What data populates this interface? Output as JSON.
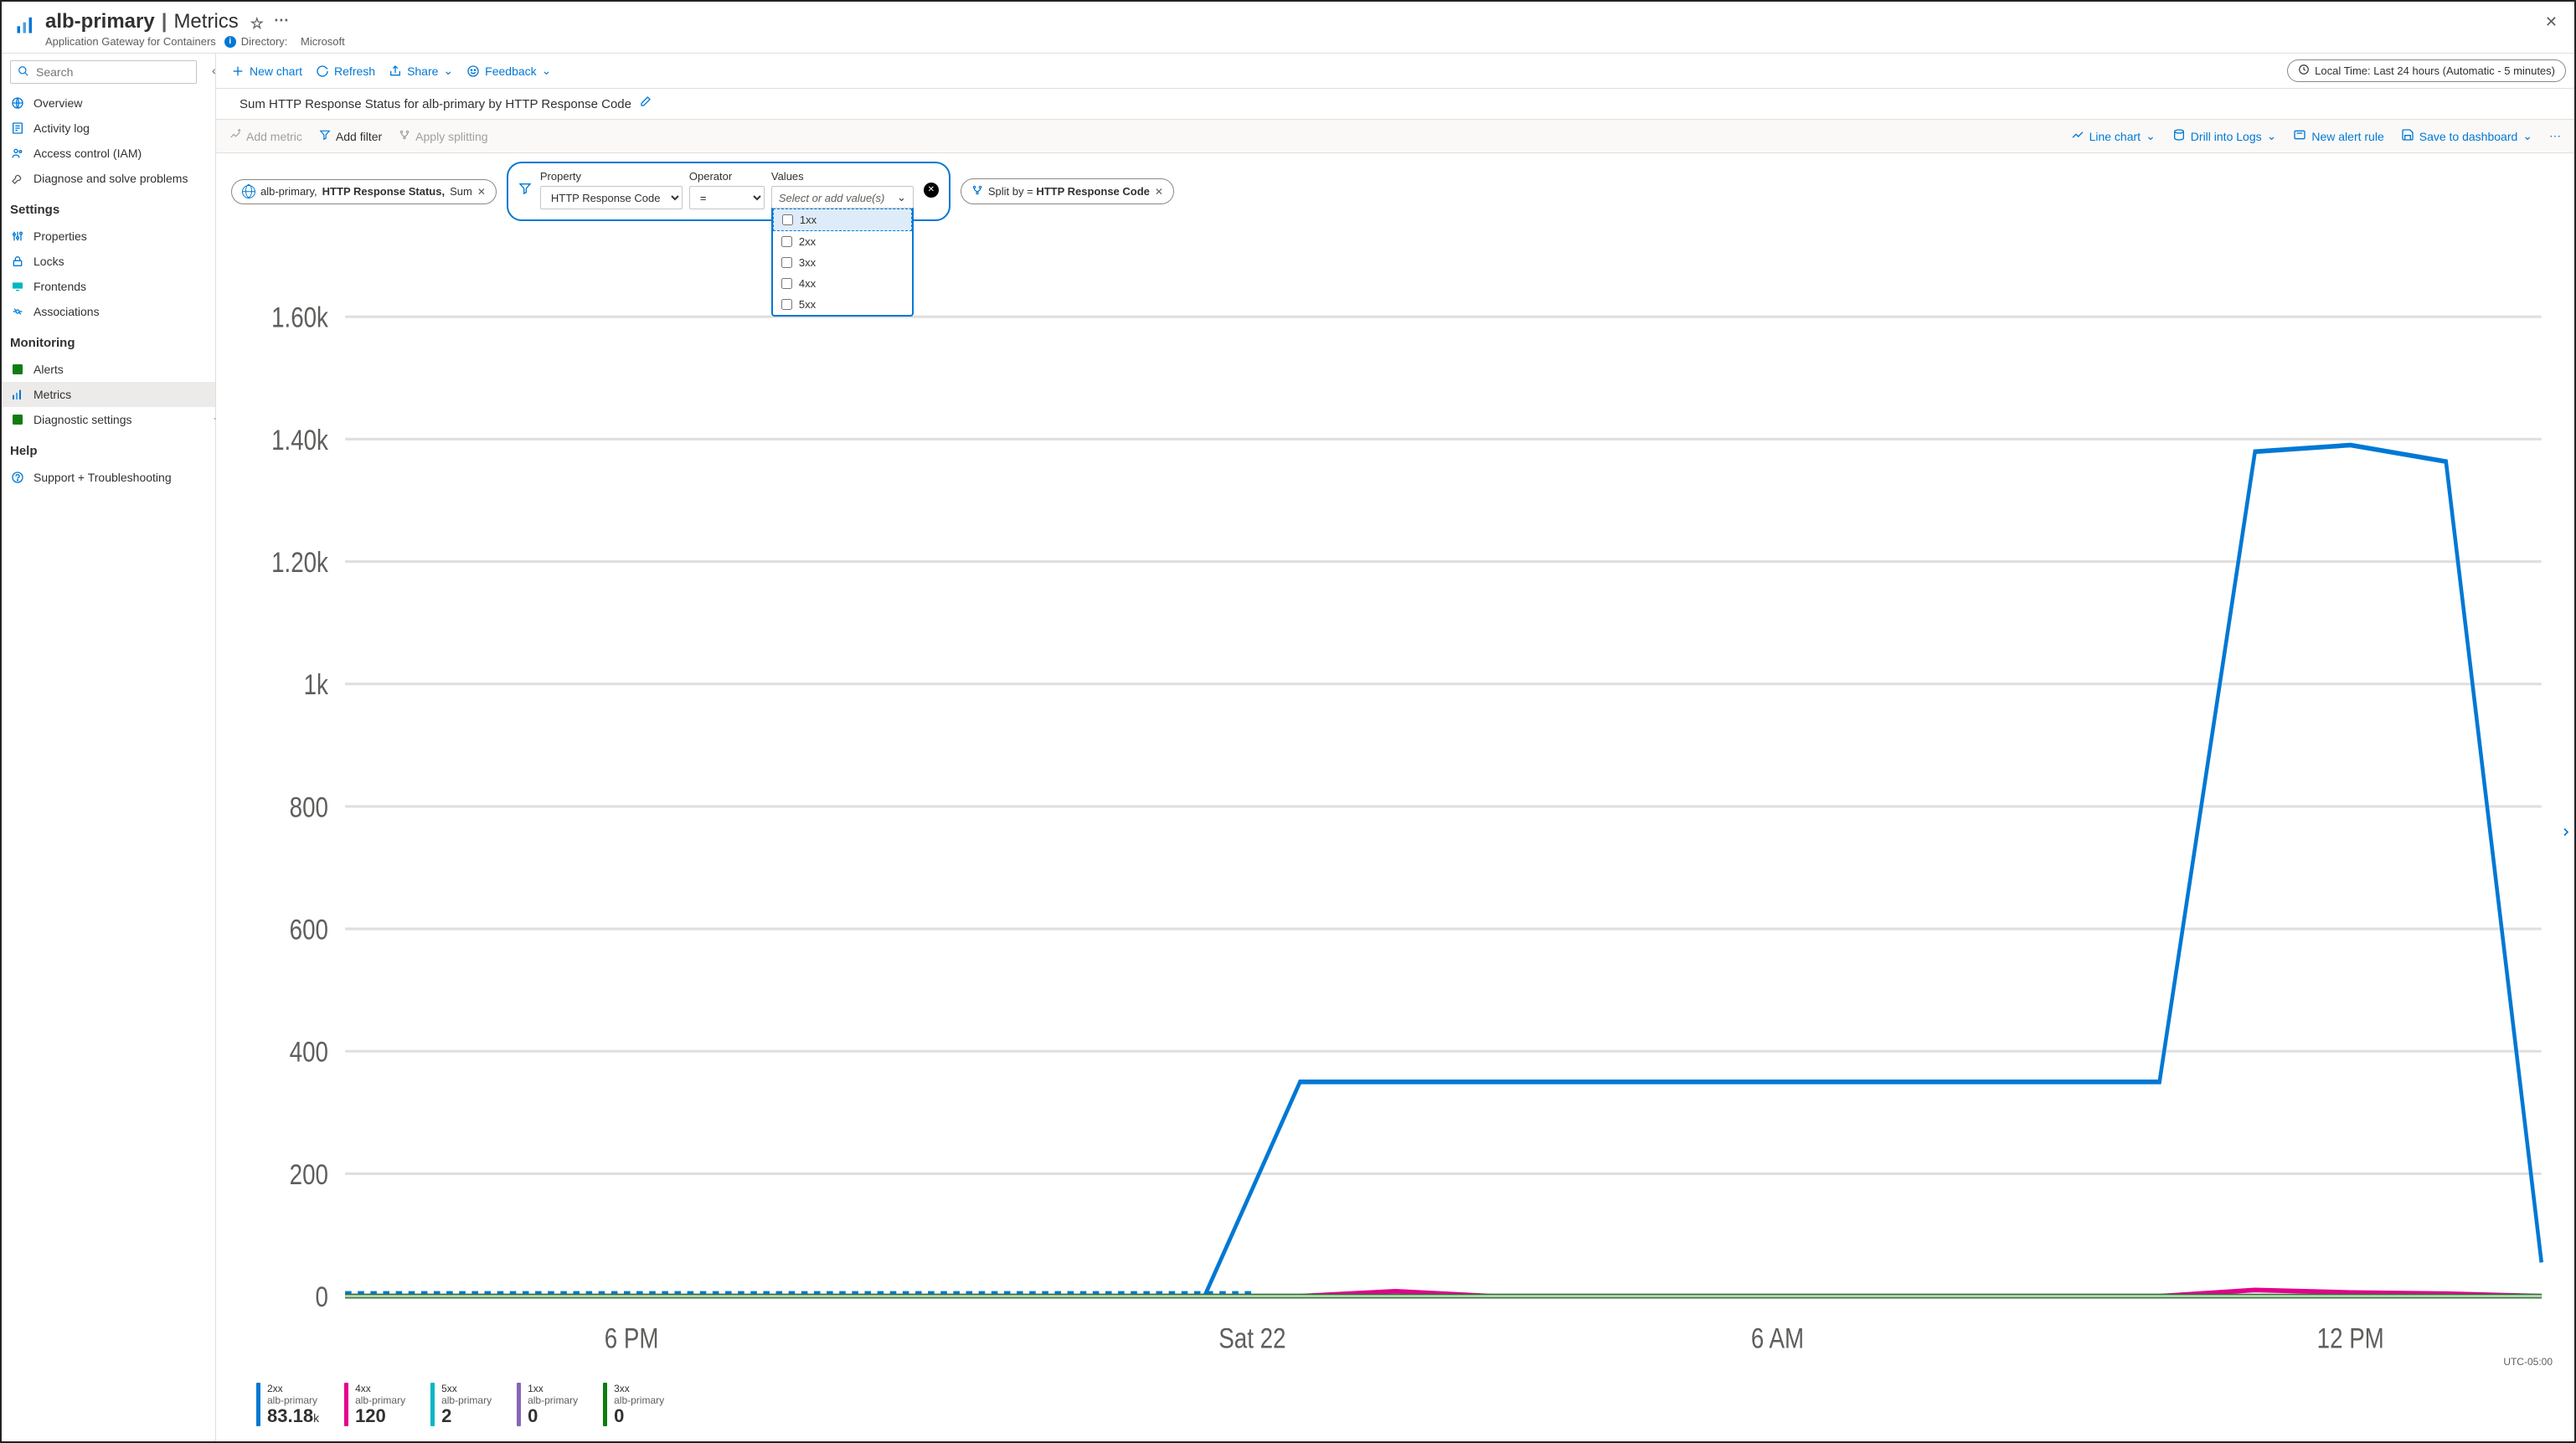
{
  "header": {
    "resource_name": "alb-primary",
    "section": "Metrics",
    "subtitle": "Application Gateway for Containers",
    "directory_label": "Directory:",
    "directory_value": "Microsoft"
  },
  "sidebar": {
    "search_placeholder": "Search",
    "items_top": [
      {
        "label": "Overview",
        "icon": "globe"
      },
      {
        "label": "Activity log",
        "icon": "log"
      },
      {
        "label": "Access control (IAM)",
        "icon": "access"
      },
      {
        "label": "Diagnose and solve problems",
        "icon": "wrench"
      }
    ],
    "section_settings": "Settings",
    "items_settings": [
      {
        "label": "Properties",
        "icon": "props"
      },
      {
        "label": "Locks",
        "icon": "lock"
      },
      {
        "label": "Frontends",
        "icon": "frontends"
      },
      {
        "label": "Associations",
        "icon": "assoc"
      }
    ],
    "section_monitoring": "Monitoring",
    "items_monitoring": [
      {
        "label": "Alerts",
        "icon": "alerts"
      },
      {
        "label": "Metrics",
        "icon": "metrics",
        "selected": true
      },
      {
        "label": "Diagnostic settings",
        "icon": "diag"
      }
    ],
    "section_help": "Help",
    "items_help": [
      {
        "label": "Support + Troubleshooting",
        "icon": "help"
      }
    ]
  },
  "toolbar": {
    "new_chart": "New chart",
    "refresh": "Refresh",
    "share": "Share",
    "feedback": "Feedback",
    "time_range": "Local Time: Last 24 hours (Automatic - 5 minutes)"
  },
  "chart_header": {
    "title": "Sum HTTP Response Status for alb-primary by HTTP Response Code",
    "add_metric": "Add metric",
    "add_filter": "Add filter",
    "apply_splitting": "Apply splitting",
    "line_chart": "Line chart",
    "drill_logs": "Drill into Logs",
    "new_alert": "New alert rule",
    "save_dashboard": "Save to dashboard"
  },
  "metric_pill": {
    "scope": "alb-primary,",
    "metric": "HTTP Response Status,",
    "agg": "Sum"
  },
  "filter": {
    "property_label": "Property",
    "property_value": "HTTP Response Code",
    "operator_label": "Operator",
    "operator_value": "=",
    "values_label": "Values",
    "values_placeholder": "Select or add value(s)",
    "options": [
      "1xx",
      "2xx",
      "3xx",
      "4xx",
      "5xx"
    ]
  },
  "split_pill": {
    "prefix": "Split by = ",
    "value": "HTTP Response Code"
  },
  "legend": [
    {
      "label": "2xx",
      "sub": "alb-primary",
      "value": "83.18",
      "suffix": "k",
      "color": "#0078d4"
    },
    {
      "label": "4xx",
      "sub": "alb-primary",
      "value": "120",
      "suffix": "",
      "color": "#e3008c"
    },
    {
      "label": "5xx",
      "sub": "alb-primary",
      "value": "2",
      "suffix": "",
      "color": "#00b7c3"
    },
    {
      "label": "1xx",
      "sub": "alb-primary",
      "value": "0",
      "suffix": "",
      "color": "#8764b8"
    },
    {
      "label": "3xx",
      "sub": "alb-primary",
      "value": "0",
      "suffix": "",
      "color": "#107c10"
    }
  ],
  "utc_label": "UTC-05:00",
  "chart_data": {
    "type": "line",
    "title": "Sum HTTP Response Status for alb-primary by HTTP Response Code",
    "ylabel": "",
    "xlabel": "",
    "ylim": [
      0,
      1700
    ],
    "y_ticks": [
      "0",
      "200",
      "400",
      "600",
      "800",
      "1k",
      "1.20k",
      "1.40k",
      "1.60k"
    ],
    "x_ticks": [
      "6 PM",
      "Sat 22",
      "6 AM",
      "12 PM"
    ],
    "x": [
      0,
      1,
      2,
      3,
      4,
      5,
      6,
      7,
      8,
      9,
      10,
      11,
      12,
      13,
      14,
      15,
      16,
      17,
      18,
      19,
      20,
      21,
      22,
      23
    ],
    "series": [
      {
        "name": "2xx",
        "color": "#0078d4",
        "values": [
          0,
          0,
          0,
          0,
          0,
          0,
          0,
          0,
          0,
          0,
          350,
          350,
          350,
          350,
          350,
          350,
          350,
          350,
          350,
          350,
          1370,
          1360,
          1380,
          55
        ]
      },
      {
        "name": "4xx",
        "color": "#e3008c",
        "values": [
          0,
          0,
          0,
          0,
          0,
          0,
          0,
          0,
          0,
          0,
          0,
          8,
          0,
          0,
          0,
          0,
          0,
          0,
          0,
          0,
          10,
          6,
          4,
          0
        ]
      },
      {
        "name": "5xx",
        "color": "#00b7c3",
        "values": [
          0,
          0,
          0,
          0,
          0,
          0,
          0,
          0,
          0,
          0,
          0,
          0,
          0,
          0,
          0,
          0,
          0,
          0,
          0,
          0,
          0,
          0,
          0,
          0
        ]
      },
      {
        "name": "1xx",
        "color": "#8764b8",
        "values": [
          0,
          0,
          0,
          0,
          0,
          0,
          0,
          0,
          0,
          0,
          0,
          0,
          0,
          0,
          0,
          0,
          0,
          0,
          0,
          0,
          0,
          0,
          0,
          0
        ]
      },
      {
        "name": "3xx",
        "color": "#107c10",
        "values": [
          0,
          0,
          0,
          0,
          0,
          0,
          0,
          0,
          0,
          0,
          0,
          0,
          0,
          0,
          0,
          0,
          0,
          0,
          0,
          0,
          0,
          0,
          0,
          0
        ]
      }
    ]
  }
}
